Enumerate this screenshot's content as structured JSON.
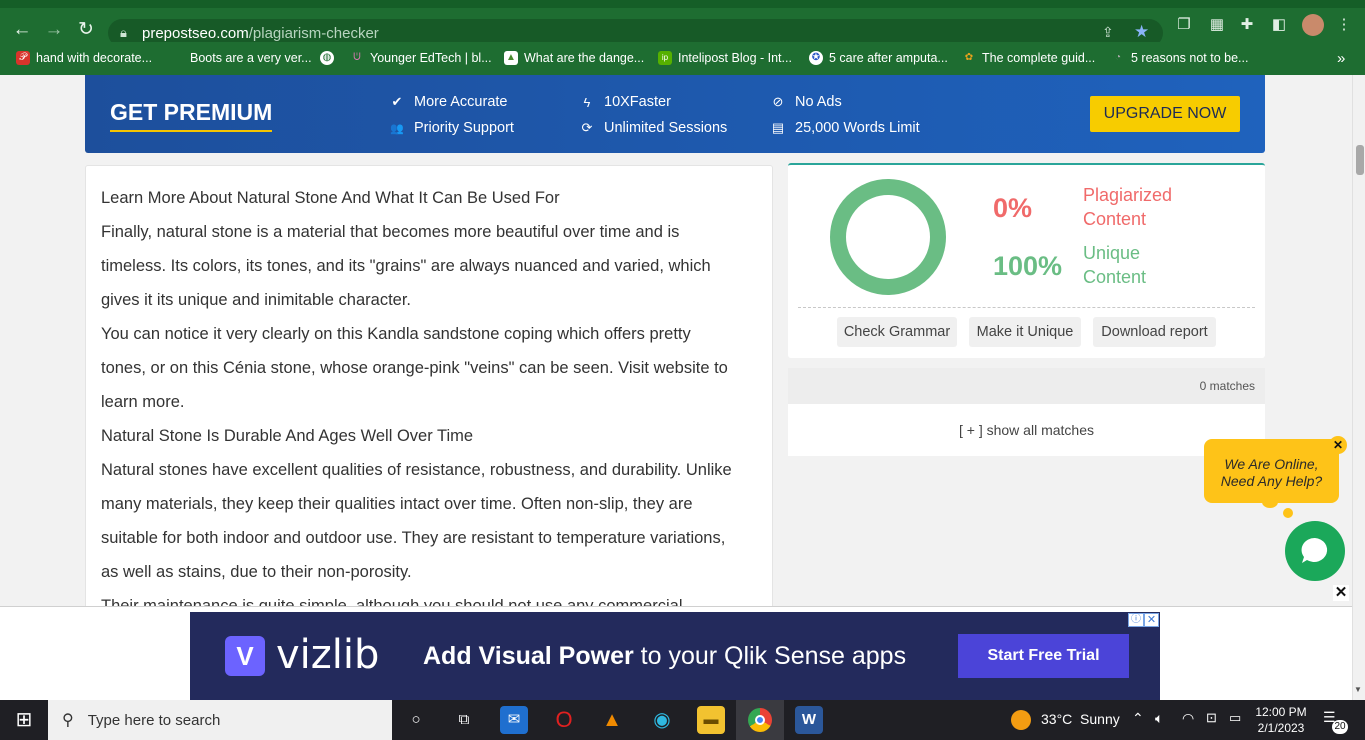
{
  "browser": {
    "url_host": "prepostseo.com",
    "url_path": "/plagiarism-checker",
    "bookmarks": [
      {
        "label": "hand with decorate...",
        "color": "#d9342b"
      },
      {
        "label": "Boots are a very ver...",
        "color": "#1e6d31"
      },
      {
        "label": "Younger EdTech | bl...",
        "color": "#b5458f"
      },
      {
        "label": "What are the dange...",
        "color": "#6aa14a"
      },
      {
        "label": "Intelipost Blog - Int...",
        "color": "#56b000"
      },
      {
        "label": "5 care after amputa...",
        "color": "#2b57c7"
      },
      {
        "label": "The complete guid...",
        "color": "#e8a21c"
      },
      {
        "label": "5 reasons not to be...",
        "color": "#555555"
      }
    ],
    "more_label": "»"
  },
  "premium": {
    "title": "GET PREMIUM",
    "features": [
      {
        "icon": "check-circle-icon",
        "glyph": "✔",
        "label": "More Accurate"
      },
      {
        "icon": "users-icon",
        "glyph": "👥",
        "label": "Priority Support"
      },
      {
        "icon": "bolt-icon",
        "glyph": "ϟ",
        "label": "10XFaster"
      },
      {
        "icon": "refresh-icon",
        "glyph": "⟳",
        "label": "Unlimited Sessions"
      },
      {
        "icon": "no-ads-icon",
        "glyph": "⊘",
        "label": "No Ads"
      },
      {
        "icon": "document-icon",
        "glyph": "▤",
        "label": "25,000 Words Limit"
      }
    ],
    "upgrade_label": "UPGRADE NOW",
    "accent": "#f7cc00"
  },
  "article": {
    "paragraphs": [
      "Learn More About Natural Stone And What It Can Be Used For",
      "Finally, natural stone is a material that becomes more beautiful over time and is",
      "timeless. Its colors, its tones, and its \"grains\" are always nuanced and varied, which",
      "gives it its unique and inimitable character.",
      "You can notice it very clearly on this Kandla sandstone coping which offers pretty",
      "tones, or on this Cénia stone, whose orange-pink \"veins\" can be seen. Visit website to",
      "learn more.",
      "Natural Stone Is Durable And Ages Well Over Time",
      "Natural stones have excellent qualities of resistance, robustness, and durability. Unlike",
      "many materials, they keep their qualities intact over time. Often non-slip, they are",
      "suitable for both indoor and outdoor use. They are resistant to temperature variations,",
      "as well as stains, due to their non-porosity.",
      "Their maintenance is quite simple, although you should not use any commercial"
    ]
  },
  "results": {
    "plagiarized_pct": "0%",
    "plagiarized_label_1": "Plagiarized",
    "plagiarized_label_2": "Content",
    "plagiarized_color": "#f06a6a",
    "unique_pct": "100%",
    "unique_label_1": "Unique",
    "unique_label_2": "Content",
    "unique_color": "#6abd84",
    "unique_fraction": 1.0,
    "actions": [
      "Check Grammar",
      "Make it Unique",
      "Download report"
    ],
    "matches_label": "0 matches",
    "show_all_label": "[ + ] show all matches"
  },
  "chat": {
    "line1": "We Are Online,",
    "line2": "Need Any Help?",
    "close": "✕"
  },
  "ad": {
    "brand": "vizlib",
    "headline_bold": "Add Visual Power",
    "headline_rest": " to your Qlik Sense apps",
    "cta": "Start Free Trial",
    "info": "ⓘ",
    "x": "✕",
    "close": "✕"
  },
  "taskbar": {
    "search_placeholder": "Type here to search",
    "weather": "33°C  Sunny",
    "time": "12:00 PM",
    "date": "2/1/2023",
    "notifications": "20"
  }
}
